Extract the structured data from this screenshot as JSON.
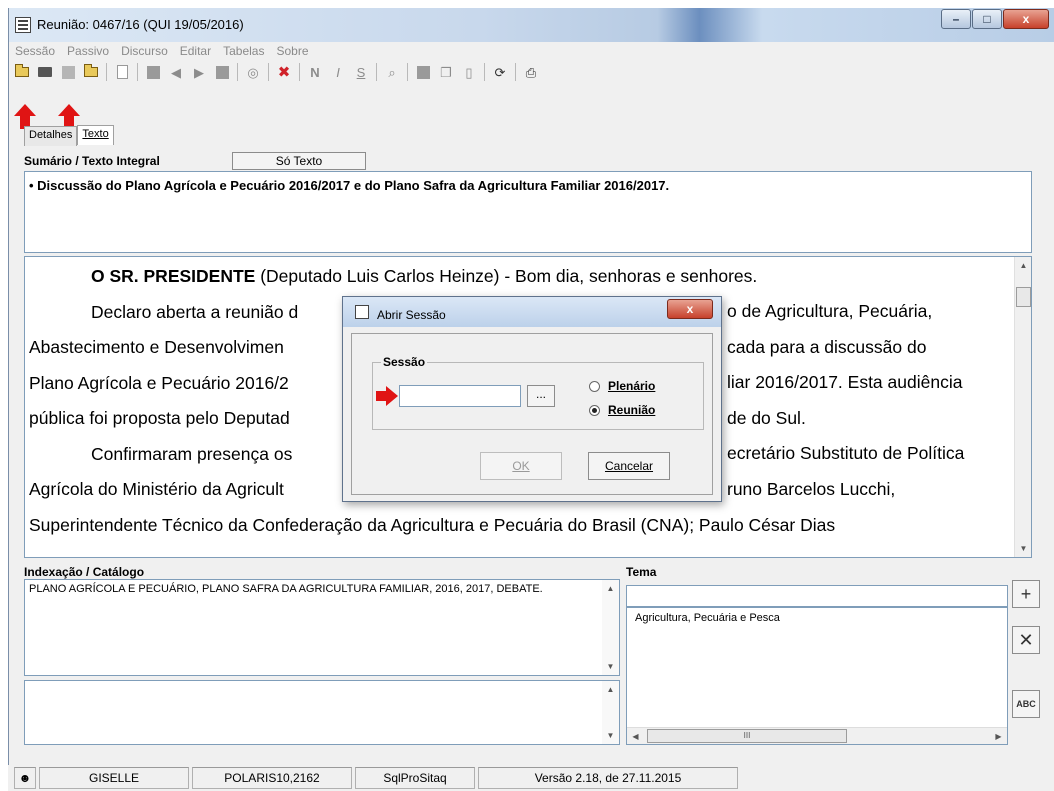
{
  "window": {
    "title": "Reunião: 0467/16 (QUI 19/05/2016)",
    "min": "–",
    "max": "□",
    "close": "x"
  },
  "menu": [
    "Sessão",
    "Passivo",
    "Discurso",
    "Editar",
    "Tabelas",
    "Sobre"
  ],
  "toolbar_icons": [
    "open-folder-icon",
    "printer-check-icon",
    "database-icon",
    "folder-icon",
    "new-document-icon",
    "record-icon",
    "back-icon",
    "forward-icon",
    "stop-icon",
    "audio-icon",
    "delete-icon",
    "bold-icon",
    "italic-icon",
    "strike-icon",
    "find-icon",
    "block-icon",
    "note-icon",
    "page-icon",
    "refresh-icon",
    "print-icon"
  ],
  "tabs": {
    "details": "Detalhes",
    "text": "Texto"
  },
  "summary": {
    "label": "Sumário / Texto Integral",
    "button": "Só Texto",
    "content": "• Discussão do Plano Agrícola e Pecuário 2016/2017 e do Plano Safra da Agricultura Familiar 2016/2017."
  },
  "main_text": {
    "lines": [
      {
        "bold": "O SR. PRESIDENTE",
        "text": " (Deputado Luis Carlos Heinze) - Bom dia, senhoras e senhores."
      },
      {
        "text": "Declaro aberta a reunião d"
      },
      {
        "text": "Abastecimento e Desenvolvimen"
      },
      {
        "text": "Plano Agrícola e Pecuário 2016/2"
      },
      {
        "text": "pública foi proposta pelo Deputad"
      },
      {
        "text": "Confirmaram presença os"
      },
      {
        "text": "Agrícola do Ministério da Agricult"
      },
      {
        "text": "Superintendente Técnico da Confederação da Agricultura e Pecuária do Brasil (CNA); Paulo César Dias"
      }
    ],
    "right_fragments": [
      "o de Agricultura, Pecuária,",
      "cada para a discussão do",
      "liar 2016/2017. Esta audiência",
      "de do Sul.",
      "ecretário Substituto de Política",
      "runo Barcelos Lucchi,"
    ]
  },
  "index": {
    "label": "Indexação / Catálogo",
    "content": "PLANO AGRÍCOLA E PECUÁRIO, PLANO SAFRA DA AGRICULTURA FAMILIAR, 2016, 2017, DEBATE."
  },
  "tema": {
    "label": "Tema",
    "items": [
      "Agricultura, Pecuária e Pesca"
    ],
    "scroll_thumb": "III"
  },
  "side_buttons": {
    "add": "+",
    "remove": "✕",
    "spell": "ABC"
  },
  "status": [
    "GISELLE",
    "POLARIS10,2162",
    "SqlProSitaq",
    "Versão 2.18, de 27.11.2015"
  ],
  "dialog": {
    "title": "Abrir Sessão",
    "close": "x",
    "group": "Sessão",
    "input_value": "",
    "browse": "...",
    "options": {
      "plenario": "Plenário",
      "reuniao": "Reunião"
    },
    "selected": "reuniao",
    "ok": "OK",
    "cancel": "Cancelar"
  }
}
